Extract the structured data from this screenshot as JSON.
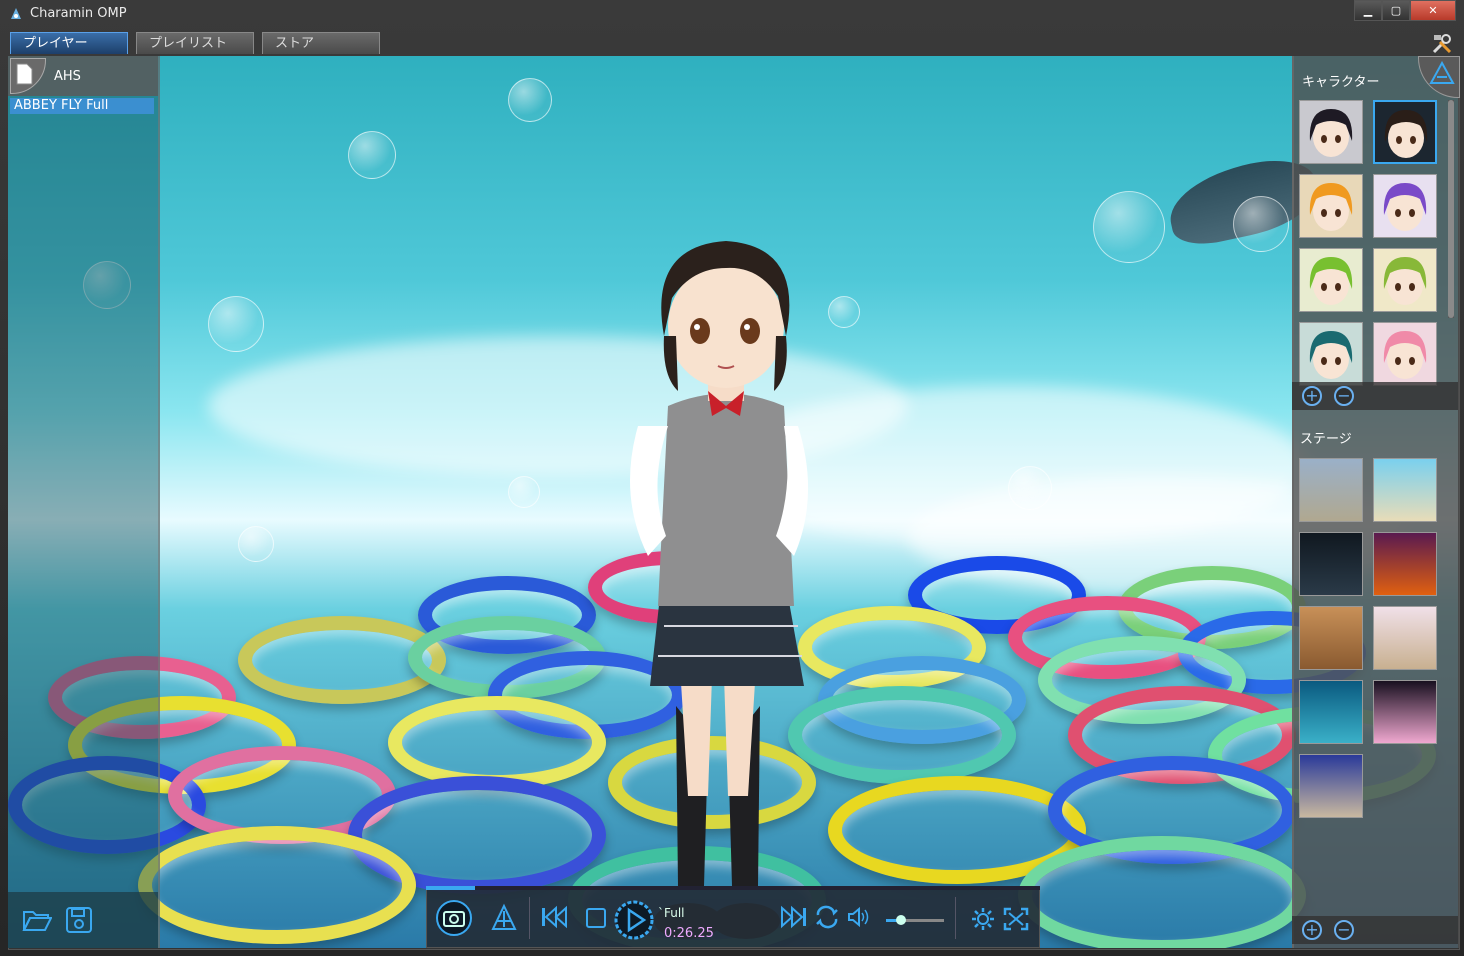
{
  "window": {
    "title": "Charamin OMP",
    "minimize": "▁",
    "maximize": "▢",
    "close": "✕"
  },
  "tabs": [
    {
      "label": "プレイヤー",
      "active": true
    },
    {
      "label": "プレイリスト",
      "active": false
    },
    {
      "label": "ストア",
      "active": false
    }
  ],
  "playlist_panel": {
    "title": "AHS",
    "items": [
      {
        "label": "ABBEY FLY Full",
        "selected": true
      }
    ]
  },
  "right_panel": {
    "character_title": "キャラクター",
    "stage_title": "ステージ",
    "characters": [
      {
        "name": "twin-tail-dark",
        "selected": false,
        "hair": "#1e1a24",
        "bg": "#c9c9cf"
      },
      {
        "name": "short-brown",
        "selected": true,
        "hair": "#2a1e18",
        "bg": "#1c2630"
      },
      {
        "name": "orange-hair",
        "selected": false,
        "hair": "#f09a20",
        "bg": "#e8d8b8"
      },
      {
        "name": "purple-hood",
        "selected": false,
        "hair": "#7a4ac8",
        "bg": "#e8e0f0"
      },
      {
        "name": "green-goggles",
        "selected": false,
        "hair": "#78c030",
        "bg": "#e8ecd0"
      },
      {
        "name": "green-orange",
        "selected": false,
        "hair": "#88b838",
        "bg": "#f0e8c8"
      },
      {
        "name": "teal-hair",
        "selected": false,
        "hair": "#1a6a70",
        "bg": "#c8dcd8"
      },
      {
        "name": "pink-hair",
        "selected": false,
        "hair": "#f08aa8",
        "bg": "#f0d8e0"
      }
    ],
    "stages": [
      {
        "name": "school-building",
        "top": "#9ab0c8",
        "bottom": "#b0a890"
      },
      {
        "name": "beach",
        "top": "#7ad0ee",
        "bottom": "#e8dcb8"
      },
      {
        "name": "dark-hall",
        "top": "#101820",
        "bottom": "#2a3a48"
      },
      {
        "name": "halloween-night",
        "top": "#5a1a50",
        "bottom": "#e06010"
      },
      {
        "name": "wooden-hallway",
        "top": "#c89058",
        "bottom": "#8a5a30"
      },
      {
        "name": "playground",
        "top": "#f0e0e8",
        "bottom": "#c8b090"
      },
      {
        "name": "underwater-bubbles",
        "top": "#0a5a80",
        "bottom": "#3ab0c8"
      },
      {
        "name": "pink-stage",
        "top": "#181020",
        "bottom": "#f0a8d0"
      },
      {
        "name": "night-shrine",
        "top": "#2a3a9a",
        "bottom": "#c8b8a0"
      }
    ]
  },
  "player": {
    "track": "Full",
    "track_prefix": "`",
    "time": "0:26.25",
    "progress": 0.08,
    "volume": 0.25
  },
  "icons": {
    "camera": "camera-icon",
    "logo": "charamin-logo-icon",
    "prev": "skip-back-icon",
    "stop": "stop-icon",
    "play": "play-icon",
    "next": "skip-forward-icon",
    "repeat": "repeat-icon",
    "volume": "volume-icon",
    "settings": "gear-icon",
    "fullscreen": "fullscreen-icon"
  },
  "colors": {
    "accent": "#3aa8f0",
    "selected_row": "#3b8fd0",
    "active_tab": "#1d3f6a"
  }
}
